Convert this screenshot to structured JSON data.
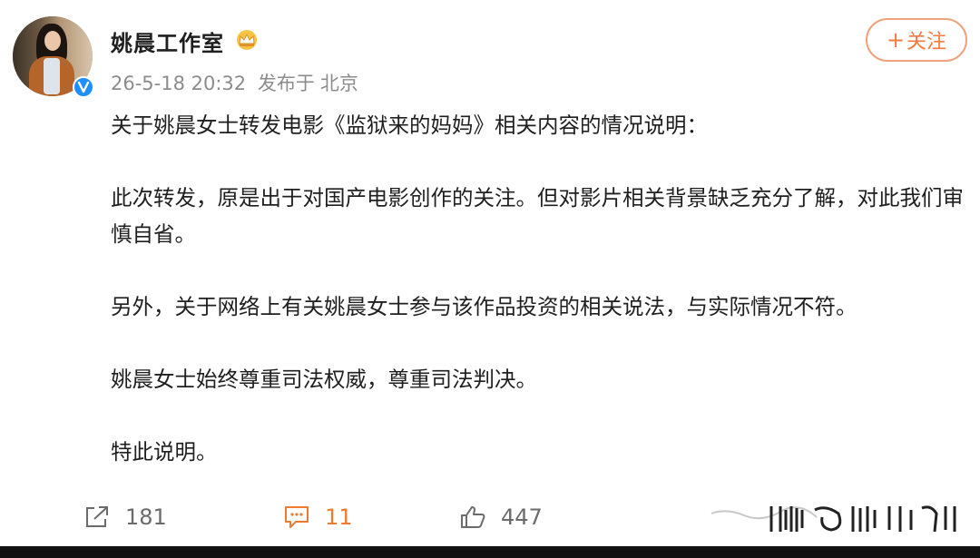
{
  "post": {
    "author": "姚晨工作室",
    "timestamp": "26-5-18 20:32",
    "source_prefix": "发布于",
    "location": "北京",
    "follow_label": "关注",
    "follow_plus": "+",
    "paragraphs": [
      "关于姚晨女士转发电影《监狱来的妈妈》相关内容的情况说明：",
      "此次转发，原是出于对国产电影创作的关注。但对影片相关背景缺乏充分了解，对此我们审慎自省。",
      "另外，关于网络上有关姚晨女士参与该作品投资的相关说法，与实际情况不符。",
      "姚晨女士始终尊重司法权威，尊重司法判决。",
      "特此说明。"
    ]
  },
  "actions": {
    "share_count": "181",
    "comment_count": "11",
    "like_count": "447"
  },
  "icons": {
    "avatar_badge": "verified-icon",
    "crown": "crown-icon",
    "share": "share-icon",
    "comment": "comment-icon",
    "like": "thumbs-up-icon"
  },
  "colors": {
    "accent": "#f27b40",
    "verified": "#1f8fff",
    "meta_text": "#8c8c8c"
  }
}
